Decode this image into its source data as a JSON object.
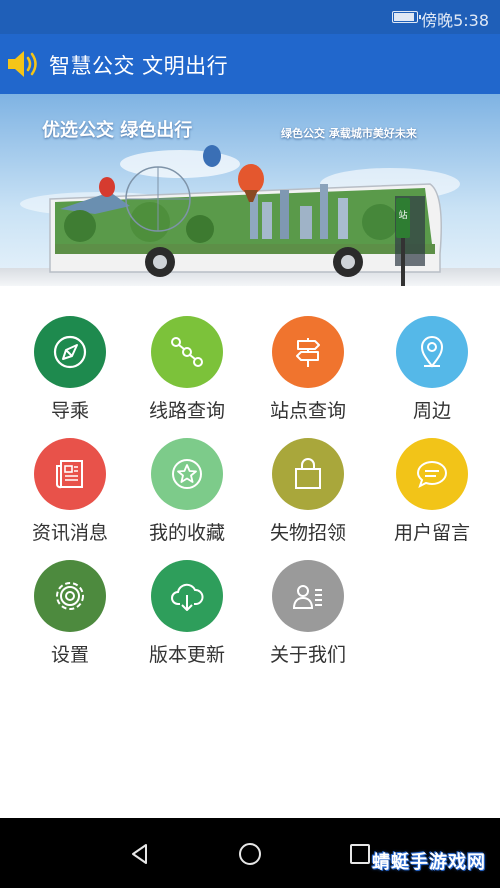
{
  "status_bar": {
    "time": "傍晚5:38",
    "battery_level": 0.95,
    "battery_icon": "battery-icon"
  },
  "header": {
    "title": "智慧公交 文明出行",
    "icon": "speaker-icon"
  },
  "banner": {
    "headline": "优选公交 绿色出行",
    "slogan": "绿色公交 承载城市美好未来",
    "stop_sign_text": "站"
  },
  "menu": [
    {
      "label": "导乘",
      "icon": "compass-navigation-icon",
      "color": "#1e8a4e"
    },
    {
      "label": "线路查询",
      "icon": "route-nodes-icon",
      "color": "#7cc23a"
    },
    {
      "label": "站点查询",
      "icon": "signpost-icon",
      "color": "#f0742e"
    },
    {
      "label": "周边",
      "icon": "location-pin-icon",
      "color": "#55b8e8"
    },
    {
      "label": "资讯消息",
      "icon": "newspaper-icon",
      "color": "#e8524a"
    },
    {
      "label": "我的收藏",
      "icon": "star-icon",
      "color": "#7dcb8a"
    },
    {
      "label": "失物招领",
      "icon": "shopping-bag-icon",
      "color": "#a9a73b"
    },
    {
      "label": "用户留言",
      "icon": "chat-bubble-icon",
      "color": "#f2c418"
    },
    {
      "label": "设置",
      "icon": "gear-icon",
      "color": "#4d8a3e"
    },
    {
      "label": "版本更新",
      "icon": "cloud-download-icon",
      "color": "#2e9e5b"
    },
    {
      "label": "关于我们",
      "icon": "contact-card-icon",
      "color": "#9a9a9a"
    }
  ],
  "nav_bar": {
    "back_icon": "back-triangle-icon",
    "home_icon": "home-circle-icon",
    "recents_icon": "recents-square-icon"
  },
  "watermark": {
    "text": "蜻蜓手游戏网"
  }
}
